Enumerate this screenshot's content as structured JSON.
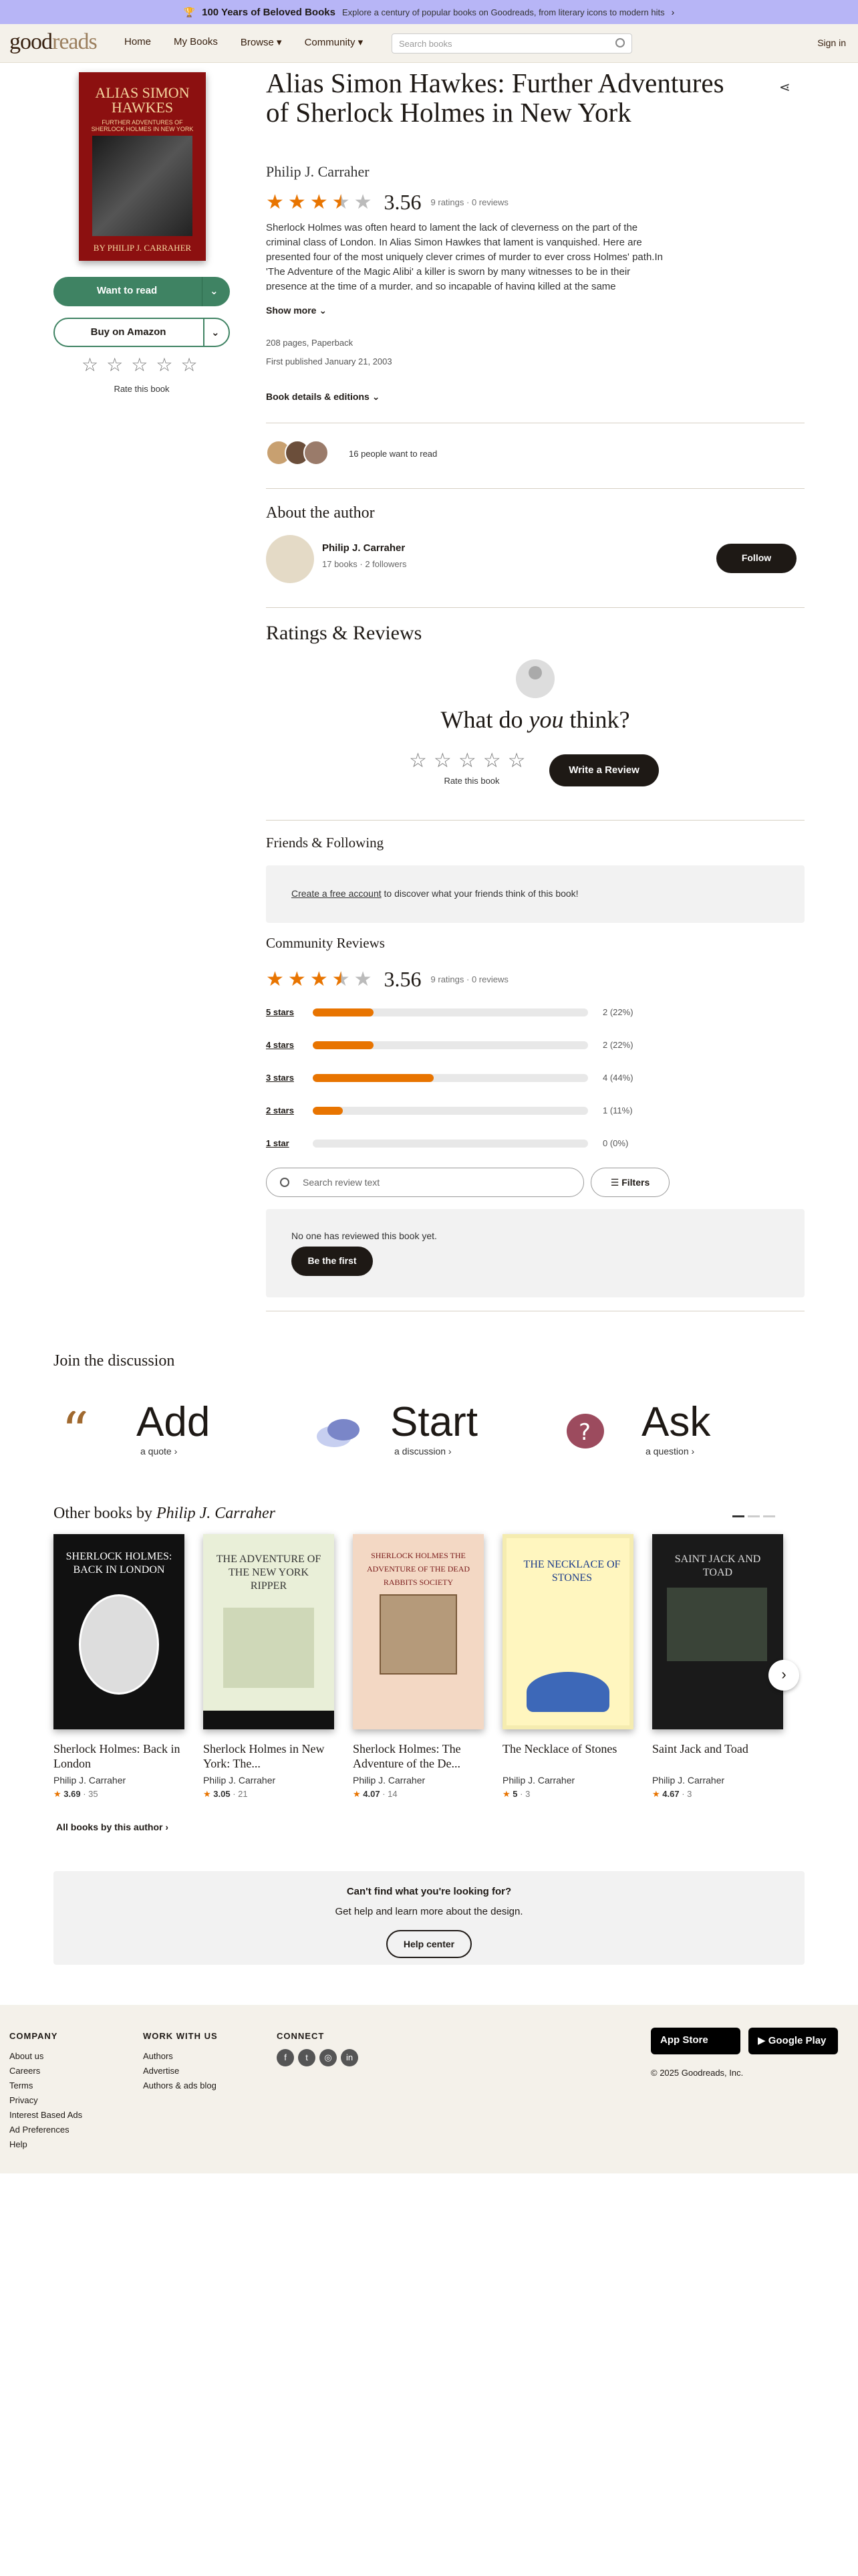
{
  "promo": {
    "title": "100 Years of Beloved Books",
    "sub": "Explore a century of popular books on Goodreads, from literary icons to modern hits"
  },
  "header": {
    "logo_a": "good",
    "logo_b": "reads",
    "nav": [
      "Home",
      "My Books",
      "Browse ▾",
      "Community ▾"
    ],
    "search_placeholder": "Search books",
    "signin": "Sign in"
  },
  "cover": {
    "title": "ALIAS SIMON HAWKES",
    "subtitle": "FURTHER ADVENTURES OF SHERLOCK HOLMES IN NEW YORK",
    "author": "BY PHILIP J. CARRAHER"
  },
  "actions": {
    "want": "Want to read",
    "amazon": "Buy on Amazon",
    "rate": "Rate this book"
  },
  "book": {
    "title": "Alias Simon Hawkes: Further Adventures of Sherlock Holmes in New York",
    "author": "Philip J. Carraher",
    "avg": "3.56",
    "counts": "9 ratings · 0 reviews",
    "stars": 3.5,
    "description": "Sherlock Holmes was often heard to lament the lack of cleverness on the part of the criminal class of London. In Alias Simon Hawkes that lament is vanquished. Here are presented four of the most uniquely clever crimes of murder to ever cross Holmes' path.In 'The Adventure of the Magic Alibi' a killer is sworn by many witnesses to be in their presence at the time of a murder, and so incapable of having killed at the same",
    "show_more": "Show more",
    "pages": "208 pages, Paperback",
    "first_published": "First published January 21, 2003",
    "details": "Book details & editions"
  },
  "social": {
    "want_count": "16 people want to read"
  },
  "about": {
    "heading": "About the author",
    "name": "Philip J. Carraher",
    "meta": "17 books · 2 followers",
    "follow": "Follow"
  },
  "ratings": {
    "heading": "Ratings & Reviews",
    "think_a": "What do ",
    "think_b": "you",
    "think_c": " think?",
    "rate": "Rate this book",
    "write": "Write a Review"
  },
  "friends": {
    "heading": "Friends & Following",
    "link": "Create a free account",
    "rest": " to discover what your friends think of this book!"
  },
  "community": {
    "heading": "Community Reviews",
    "avg": "3.56",
    "counts": "9 ratings · 0 reviews",
    "bars": [
      {
        "label": "5 stars",
        "value": "2 (22%)",
        "pct": 22
      },
      {
        "label": "4 stars",
        "value": "2 (22%)",
        "pct": 22
      },
      {
        "label": "3 stars",
        "value": "4 (44%)",
        "pct": 44
      },
      {
        "label": "2 stars",
        "value": "1 (11%)",
        "pct": 11
      },
      {
        "label": "1 star",
        "value": "0 (0%)",
        "pct": 0
      }
    ],
    "search_placeholder": "Search review text",
    "filters": "Filters",
    "none": "No one has reviewed this book yet.",
    "first": "Be the first"
  },
  "discussion": {
    "heading": "Join the discussion",
    "items": [
      {
        "big": "Add",
        "small": "a quote ›"
      },
      {
        "big": "Start",
        "small": "a discussion ›"
      },
      {
        "big": "Ask",
        "small": "a question ›"
      }
    ]
  },
  "other": {
    "heading_a": "Other books by ",
    "heading_b": "Philip J. Carraher",
    "books": [
      {
        "title": "Sherlock Holmes: Back in London",
        "author": "Philip J. Carraher",
        "rating": "3.69",
        "count": "35",
        "cover_text": "SHERLOCK HOLMES: BACK IN LONDON"
      },
      {
        "title": "Sherlock Holmes in New York: The...",
        "author": "Philip J. Carraher",
        "rating": "3.05",
        "count": "21",
        "cover_text": "THE ADVENTURE OF THE NEW YORK RIPPER"
      },
      {
        "title": "Sherlock Holmes: The Adventure of the De...",
        "author": "Philip J. Carraher",
        "rating": "4.07",
        "count": "14",
        "cover_text": "SHERLOCK HOLMES THE ADVENTURE OF THE DEAD RABBITS SOCIETY"
      },
      {
        "title": "The Necklace of Stones",
        "author": "Philip J. Carraher",
        "rating": "5",
        "count": "3",
        "cover_text": "THE NECKLACE OF STONES"
      },
      {
        "title": "Saint Jack and Toad",
        "author": "Philip J. Carraher",
        "rating": "4.67",
        "count": "3",
        "cover_text": "SAINT JACK AND TOAD"
      }
    ],
    "all": "All books by this author ›"
  },
  "help": {
    "h1": "Can't find what you're looking for?",
    "h2": "Get help and learn more about the design.",
    "btn": "Help center"
  },
  "footer": {
    "company": {
      "heading": "COMPANY",
      "links": [
        "About us",
        "Careers",
        "Terms",
        "Privacy",
        "Interest Based Ads",
        "Ad Preferences",
        "Help"
      ]
    },
    "work": {
      "heading": "WORK WITH US",
      "links": [
        "Authors",
        "Advertise",
        "Authors & ads blog"
      ]
    },
    "connect": {
      "heading": "CONNECT"
    },
    "app_store": "App Store",
    "google_play": "Google Play",
    "copyright": "© 2025 Goodreads, Inc."
  }
}
